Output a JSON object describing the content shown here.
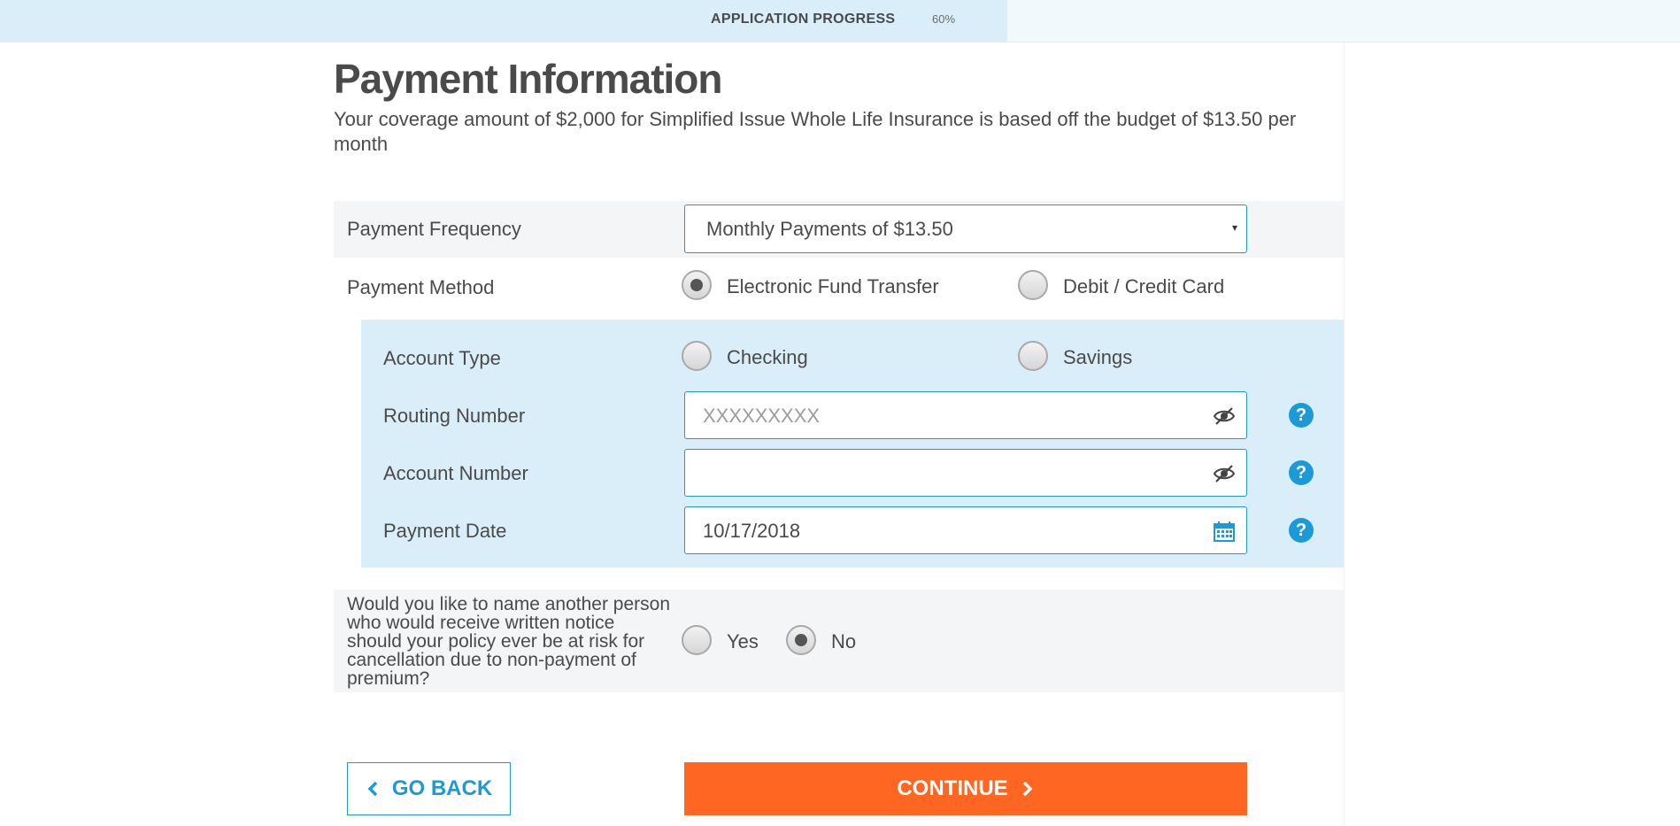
{
  "progress": {
    "label": "APPLICATION PROGRESS",
    "percent_text": "60%",
    "percent_value": 60
  },
  "page": {
    "title": "Payment Information",
    "subtitle": "Your coverage amount of $2,000 for Simplified Issue Whole Life Insurance is based off the budget of $13.50 per month"
  },
  "payment_frequency": {
    "label": "Payment Frequency",
    "selected": "Monthly Payments of $13.50"
  },
  "payment_method": {
    "label": "Payment Method",
    "options": [
      {
        "label": "Electronic Fund Transfer",
        "checked": true
      },
      {
        "label": "Debit / Credit Card",
        "checked": false
      }
    ]
  },
  "account_type": {
    "label": "Account Type",
    "options": [
      {
        "label": "Checking",
        "checked": false
      },
      {
        "label": "Savings",
        "checked": false
      }
    ]
  },
  "routing_number": {
    "label": "Routing Number",
    "value": "",
    "placeholder": "XXXXXXXXX"
  },
  "account_number": {
    "label": "Account Number",
    "value": "",
    "placeholder": ""
  },
  "payment_date": {
    "label": "Payment Date",
    "value": "10/17/2018"
  },
  "notice_question": {
    "text": "Would you like to name another person who would receive written notice should your policy ever be at risk for cancellation due to non-payment of premium?",
    "options": [
      {
        "label": "Yes",
        "checked": false
      },
      {
        "label": "No",
        "checked": true
      }
    ]
  },
  "buttons": {
    "back": "GO BACK",
    "continue": "CONTINUE"
  },
  "icons": {
    "visibility_toggle": "eye-slash-icon",
    "calendar": "calendar-icon",
    "help": "question-circle-icon",
    "back_chevron": "chevron-left-icon",
    "continue_chevron": "chevron-right-icon"
  },
  "colors": {
    "accent_blue": "#1a9ad6",
    "continue_orange": "#fe6621",
    "panel_blue": "#d9eef8",
    "row_gray": "#f4f5f6"
  }
}
